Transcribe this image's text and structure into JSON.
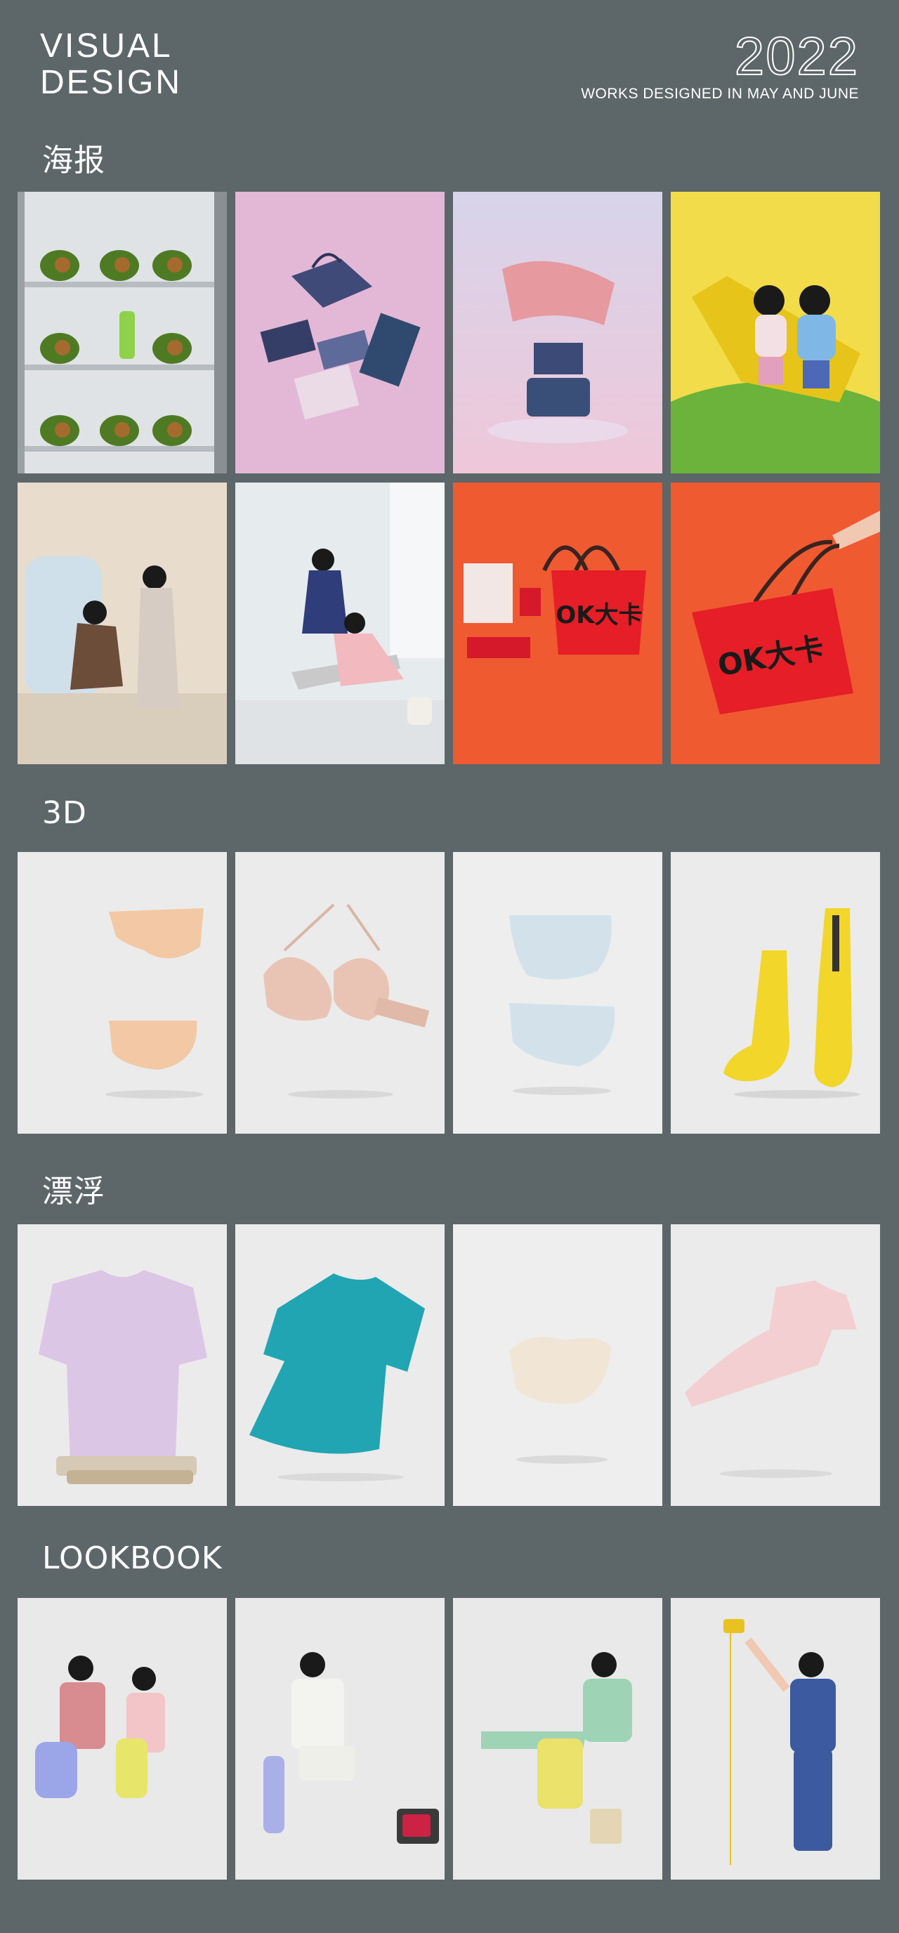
{
  "header": {
    "title_line1": "VISUAL",
    "title_line2": "DESIGN",
    "year": "2022",
    "subtitle": "WORKS DESIGNED IN MAY AND JUNE"
  },
  "sections": [
    {
      "title": "海报"
    },
    {
      "title": "3D"
    },
    {
      "title": "漂浮"
    },
    {
      "title": "LOOKBOOK"
    }
  ],
  "poster_tiles": {
    "bag_lettering": "OK大卡"
  },
  "colors": {
    "background": "#5d6669",
    "text": "#ffffff",
    "poster_pink": "#e3b8d6",
    "poster_yellow": "#f2dc4a",
    "poster_orange": "#ef5a31",
    "studio_gray": "#ebebeb",
    "avocado_green": "#5f8a2a",
    "sock_yellow": "#f2d62a",
    "tee_teal": "#21a5b2"
  }
}
